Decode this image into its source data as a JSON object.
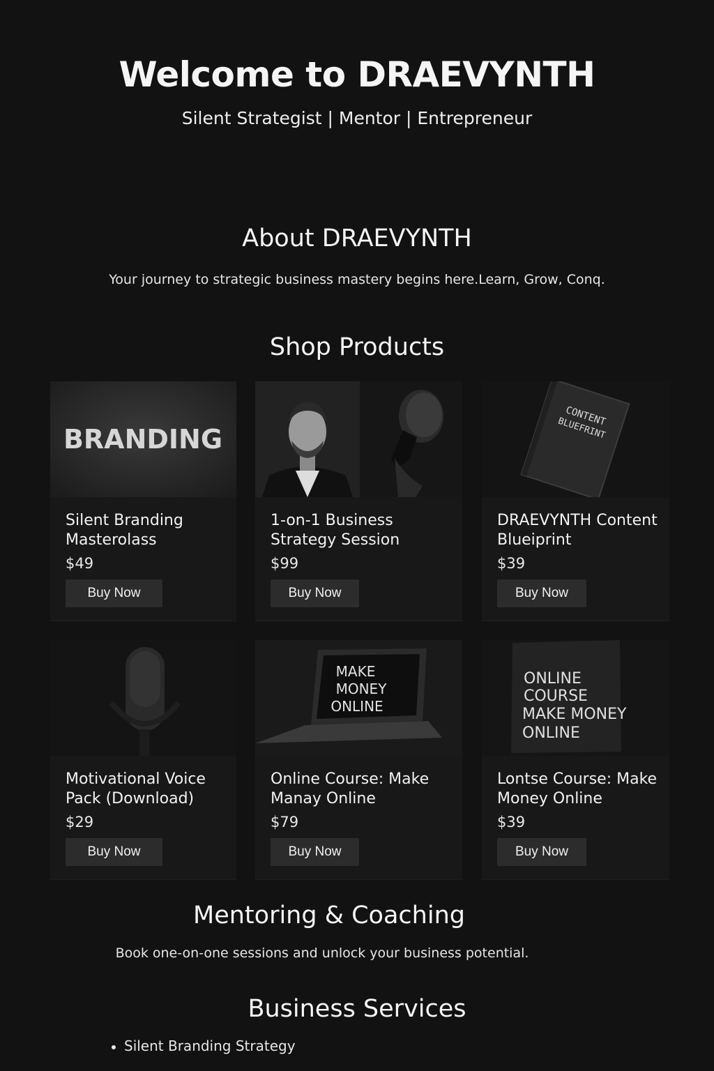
{
  "hero": {
    "title": "Welcome to DRAEVYNTH",
    "subtitle": "Silent Strategist | Mentor | Entrepreneur"
  },
  "about": {
    "title": "About DRAEVYNTH",
    "text": "Your journey to strategic business mastery begins here.Learn, Grow, Conq."
  },
  "shop": {
    "title": "Shop Products",
    "products": [
      {
        "name": "Silent Branding Masterolass",
        "price": "$49",
        "button": "Buy Now",
        "image_text": "BRANDING"
      },
      {
        "name": "1-on-1 Business Strategy Session",
        "price": "$99",
        "button": "Buy Now"
      },
      {
        "name": "DRAEVYNTH Content Blueiprint",
        "price": "$39",
        "button": "Buy Now",
        "image_text_1": "CONTENT",
        "image_text_2": "BLUEFRINT"
      },
      {
        "name": "Motivational Voice Pack (Download)",
        "price": "$29",
        "button": "Buy Now"
      },
      {
        "name": "Online Course: Make Manay Online",
        "price": "$79",
        "button": "Buy Now",
        "image_text_1": "MAKE",
        "image_text_2": "MONEY",
        "image_text_3": "ONLINE"
      },
      {
        "name": "Lontse Course: Make Money Online",
        "price": "$39",
        "button": "Buy Now",
        "image_text_1": "ONLINE",
        "image_text_2": "COURSE",
        "image_text_3": "MAKE MONEY",
        "image_text_4": "ONLINE"
      }
    ]
  },
  "mentoring": {
    "title": "Mentoring & Coaching",
    "text": "Book one-on-one sessions and unlock your business potential."
  },
  "services": {
    "title": "Business Services",
    "items": [
      "Silent Branding Strategy"
    ]
  }
}
